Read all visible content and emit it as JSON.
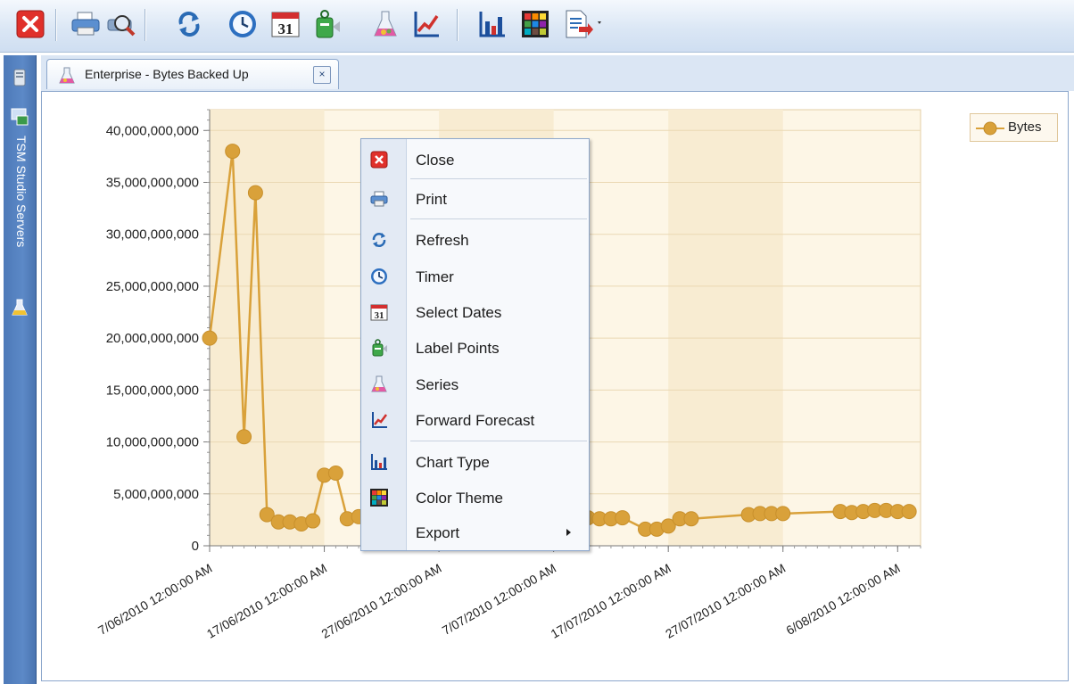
{
  "toolbar": {
    "buttons": [
      {
        "name": "close-button",
        "icon": "close-icon"
      },
      {
        "name": "print-button",
        "icon": "printer-icon"
      },
      {
        "name": "print-preview-button",
        "icon": "print-preview-icon"
      },
      {
        "name": "refresh-button",
        "icon": "refresh-icon"
      },
      {
        "name": "timer-button",
        "icon": "clock-icon"
      },
      {
        "name": "select-dates-button",
        "icon": "calendar-icon"
      },
      {
        "name": "label-points-button",
        "icon": "label-icon"
      },
      {
        "name": "series-button",
        "icon": "flask-icon"
      },
      {
        "name": "forecast-button",
        "icon": "forecast-icon"
      },
      {
        "name": "chart-type-button",
        "icon": "bar-chart-icon"
      },
      {
        "name": "color-theme-button",
        "icon": "color-grid-icon"
      },
      {
        "name": "export-button",
        "icon": "export-icon"
      }
    ]
  },
  "sidepanel": {
    "label": "TSM Studio Servers"
  },
  "tab": {
    "title": "Enterprise - Bytes Backed Up",
    "close_glyph": "×"
  },
  "legend": {
    "label": "Bytes",
    "color": "#d9a13a"
  },
  "context_menu": {
    "items": [
      {
        "label": "Close",
        "icon": "close-icon"
      },
      {
        "label": "Print",
        "icon": "printer-icon"
      },
      {
        "label": "Refresh",
        "icon": "refresh-icon"
      },
      {
        "label": "Timer",
        "icon": "clock-icon"
      },
      {
        "label": "Select Dates",
        "icon": "calendar-icon"
      },
      {
        "label": "Label Points",
        "icon": "label-icon"
      },
      {
        "label": "Series",
        "icon": "flask-icon"
      },
      {
        "label": "Forward Forecast",
        "icon": "forecast-icon"
      },
      {
        "label": "Chart Type",
        "icon": "bar-chart-icon"
      },
      {
        "label": "Color Theme",
        "icon": "color-grid-icon"
      },
      {
        "label": "Export",
        "icon": "",
        "submenu": true
      }
    ]
  },
  "chart_data": {
    "type": "line",
    "title": "",
    "xlabel": "",
    "ylabel": "",
    "ylim": [
      0,
      42000000000
    ],
    "xlim": [
      "2010-06-07",
      "2010-08-08"
    ],
    "x_tick_labels": [
      "7/06/2010 12:00:00 AM",
      "17/06/2010 12:00:00 AM",
      "27/06/2010 12:00:00 AM",
      "7/07/2010 12:00:00 AM",
      "17/07/2010 12:00:00 AM",
      "27/07/2010 12:00:00 AM",
      "6/08/2010 12:00:00 AM"
    ],
    "x_tick_dates": [
      "2010-06-07",
      "2010-06-17",
      "2010-06-27",
      "2010-07-07",
      "2010-07-17",
      "2010-07-27",
      "2010-08-06"
    ],
    "y_tick_labels": [
      "40,000,000,000",
      "35,000,000,000",
      "30,000,000,000",
      "25,000,000,000",
      "20,000,000,000",
      "15,000,000,000",
      "10,000,000,000",
      "5,000,000,000",
      "0"
    ],
    "y_tick_values": [
      40000000000,
      35000000000,
      30000000000,
      25000000000,
      20000000000,
      15000000000,
      10000000000,
      5000000000,
      0
    ],
    "grid": true,
    "legend_position": "top-right",
    "series": [
      {
        "name": "Bytes",
        "color": "#d9a13a",
        "points": [
          [
            "2010-06-07",
            20000000000
          ],
          [
            "2010-06-09",
            38000000000
          ],
          [
            "2010-06-10",
            10500000000
          ],
          [
            "2010-06-11",
            34000000000
          ],
          [
            "2010-06-12",
            3000000000
          ],
          [
            "2010-06-13",
            2300000000
          ],
          [
            "2010-06-14",
            2300000000
          ],
          [
            "2010-06-15",
            2100000000
          ],
          [
            "2010-06-16",
            2400000000
          ],
          [
            "2010-06-17",
            6800000000
          ],
          [
            "2010-06-18",
            7000000000
          ],
          [
            "2010-06-19",
            2600000000
          ],
          [
            "2010-06-20",
            2800000000
          ],
          [
            "2010-07-10",
            2700000000
          ],
          [
            "2010-07-11",
            2600000000
          ],
          [
            "2010-07-12",
            2600000000
          ],
          [
            "2010-07-13",
            2700000000
          ],
          [
            "2010-07-15",
            1600000000
          ],
          [
            "2010-07-16",
            1600000000
          ],
          [
            "2010-07-17",
            1900000000
          ],
          [
            "2010-07-18",
            2600000000
          ],
          [
            "2010-07-19",
            2600000000
          ],
          [
            "2010-07-24",
            3000000000
          ],
          [
            "2010-07-25",
            3100000000
          ],
          [
            "2010-07-26",
            3100000000
          ],
          [
            "2010-07-27",
            3100000000
          ],
          [
            "2010-08-01",
            3300000000
          ],
          [
            "2010-08-02",
            3200000000
          ],
          [
            "2010-08-03",
            3300000000
          ],
          [
            "2010-08-04",
            3400000000
          ],
          [
            "2010-08-05",
            3400000000
          ],
          [
            "2010-08-06",
            3300000000
          ],
          [
            "2010-08-07",
            3300000000
          ]
        ]
      }
    ]
  }
}
